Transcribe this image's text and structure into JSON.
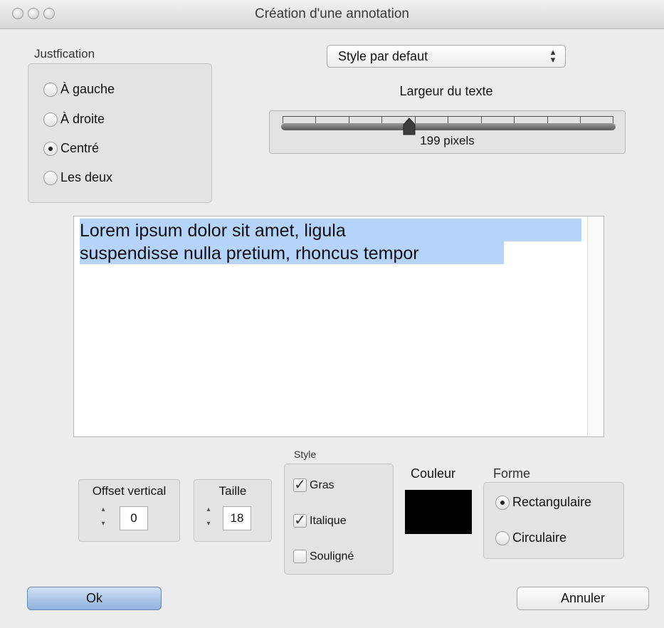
{
  "window": {
    "title": "Création d'une annotation"
  },
  "justification": {
    "label": "Justfication",
    "options": [
      {
        "label": "À gauche",
        "selected": false
      },
      {
        "label": "À droite",
        "selected": false
      },
      {
        "label": "Centré",
        "selected": true
      },
      {
        "label": "Les deux",
        "selected": false
      }
    ]
  },
  "style_popup": {
    "value": "Style par defaut"
  },
  "text_width": {
    "label": "Largeur du texte",
    "value_text": "199  pixels",
    "value": 199
  },
  "editor": {
    "lines": [
      "Lorem ipsum dolor sit amet, ligula",
      "suspendisse nulla pretium, rhoncus tempor"
    ]
  },
  "offset_vertical": {
    "label": "Offset vertical",
    "value": "0"
  },
  "taille": {
    "label": "Taille",
    "value": "18"
  },
  "style_group": {
    "label": "Style",
    "options": [
      {
        "label": "Gras",
        "checked": true
      },
      {
        "label": "Italique",
        "checked": true
      },
      {
        "label": "Souligné",
        "checked": false
      }
    ]
  },
  "couleur": {
    "label": "Couleur",
    "color": "#000000"
  },
  "forme": {
    "label": "Forme",
    "options": [
      {
        "label": "Rectangulaire",
        "selected": true
      },
      {
        "label": "Circulaire",
        "selected": false
      }
    ]
  },
  "buttons": {
    "ok": "Ok",
    "cancel": "Annuler"
  },
  "colors": {
    "selection": "#b5d3fb",
    "default_button": "#8fb2dd"
  }
}
